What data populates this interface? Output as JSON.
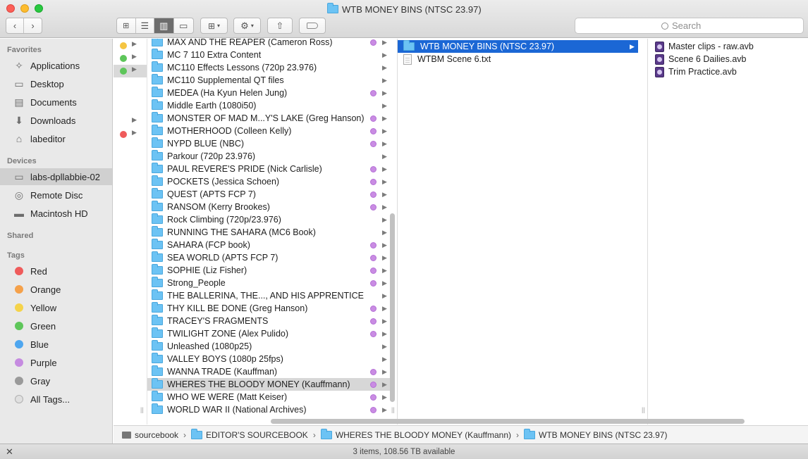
{
  "window": {
    "title": "WTB MONEY BINS (NTSC 23.97)"
  },
  "toolbar": {
    "search_placeholder": "Search",
    "view_icons": [
      "icon-view-icon",
      "list-view-icon",
      "column-view-icon",
      "cover-flow-icon"
    ],
    "active_view": "column"
  },
  "sidebar": {
    "favorites_label": "Favorites",
    "favorites": [
      {
        "label": "Applications",
        "icon": "applications-icon"
      },
      {
        "label": "Desktop",
        "icon": "desktop-icon"
      },
      {
        "label": "Documents",
        "icon": "documents-icon"
      },
      {
        "label": "Downloads",
        "icon": "downloads-icon"
      },
      {
        "label": "labeditor",
        "icon": "home-icon"
      }
    ],
    "devices_label": "Devices",
    "devices": [
      {
        "label": "labs-dpllabbie-02",
        "icon": "computer-icon",
        "selected": true
      },
      {
        "label": "Remote Disc",
        "icon": "remote-disc-icon"
      },
      {
        "label": "Macintosh HD",
        "icon": "hard-drive-icon"
      }
    ],
    "shared_label": "Shared",
    "tags_label": "Tags",
    "tags": [
      {
        "label": "Red",
        "color": "#ef5b5b"
      },
      {
        "label": "Orange",
        "color": "#f5a14a"
      },
      {
        "label": "Yellow",
        "color": "#f5d34a"
      },
      {
        "label": "Green",
        "color": "#5ec65a"
      },
      {
        "label": "Blue",
        "color": "#4ea6ef"
      },
      {
        "label": "Purple",
        "color": "#c58be0"
      },
      {
        "label": "Gray",
        "color": "#9a9a9a"
      },
      {
        "label": "All Tags...",
        "color": "#e0e0e0"
      }
    ]
  },
  "column1": {
    "rows": [
      {
        "tag_color": "#f5c542",
        "has_arrow": true,
        "selected": false
      },
      {
        "tag_color": "#5ec65a",
        "has_arrow": true,
        "selected": false
      },
      {
        "tag_color": "#5ec65a",
        "has_arrow": true,
        "selected": true
      },
      {
        "tag_color": "",
        "has_arrow": false,
        "selected": false
      },
      {
        "tag_color": "",
        "has_arrow": true,
        "selected": false
      },
      {
        "tag_color": "",
        "has_arrow": false,
        "selected": false
      },
      {
        "tag_color": "",
        "has_arrow": true,
        "selected": false
      },
      {
        "tag_color": "#ef5b5b",
        "has_arrow": true,
        "selected": false
      }
    ]
  },
  "column2": {
    "folders": [
      {
        "name": "MAX AND THE REAPER (Cameron Ross)",
        "purple": true
      },
      {
        "name": "MC 7 110 Extra Content",
        "purple": false
      },
      {
        "name": "MC110 Effects Lessons (720p 23.976)",
        "purple": false
      },
      {
        "name": "MC110 Supplemental QT files",
        "purple": false
      },
      {
        "name": "MEDEA (Ha Kyun Helen Jung)",
        "purple": true
      },
      {
        "name": "Middle Earth (1080i50)",
        "purple": false
      },
      {
        "name": "MONSTER OF MAD M...Y'S LAKE (Greg Hanson)",
        "purple": true
      },
      {
        "name": "MOTHERHOOD (Colleen Kelly)",
        "purple": true
      },
      {
        "name": "NYPD BLUE (NBC)",
        "purple": true
      },
      {
        "name": "Parkour (720p 23.976)",
        "purple": false
      },
      {
        "name": "PAUL REVERE'S PRIDE (Nick Carlisle)",
        "purple": true
      },
      {
        "name": "POCKETS (Jessica Schoen)",
        "purple": true
      },
      {
        "name": "QUEST (APTS FCP 7)",
        "purple": true
      },
      {
        "name": "RANSOM (Kerry Brookes)",
        "purple": true
      },
      {
        "name": "Rock Climbing (720p/23.976)",
        "purple": false
      },
      {
        "name": "RUNNING THE SAHARA (MC6 Book)",
        "purple": false
      },
      {
        "name": "SAHARA (FCP book)",
        "purple": true
      },
      {
        "name": "SEA WORLD (APTS FCP 7)",
        "purple": true
      },
      {
        "name": "SOPHIE (Liz Fisher)",
        "purple": true
      },
      {
        "name": "Strong_People",
        "purple": true
      },
      {
        "name": "THE BALLERINA, THE..., AND HIS APPRENTICE",
        "purple": false
      },
      {
        "name": "THY KILL BE DONE (Greg Hanson)",
        "purple": true
      },
      {
        "name": "TRACEY'S FRAGMENTS",
        "purple": true
      },
      {
        "name": "TWILIGHT ZONE (Alex Pulido)",
        "purple": true
      },
      {
        "name": "Unleashed (1080p25)",
        "purple": false
      },
      {
        "name": "VALLEY BOYS (1080p 25fps)",
        "purple": false
      },
      {
        "name": "WANNA TRADE (Kauffman)",
        "purple": true
      },
      {
        "name": "WHERES THE BLOODY MONEY (Kauffmann)",
        "purple": true,
        "selected": true
      },
      {
        "name": "WHO WE WERE (Matt Keiser)",
        "purple": true
      },
      {
        "name": "WORLD WAR II (National Archives)",
        "purple": true
      }
    ]
  },
  "column3": {
    "items": [
      {
        "name": "WTB MONEY BINS (NTSC 23.97)",
        "kind": "folder",
        "selected": true
      },
      {
        "name": "WTBM Scene 6.txt",
        "kind": "text"
      }
    ]
  },
  "column4": {
    "items": [
      {
        "name": "Master clips - raw.avb"
      },
      {
        "name": "Scene 6 Dailies.avb"
      },
      {
        "name": "Trim Practice.avb"
      }
    ]
  },
  "pathbar": {
    "items": [
      {
        "label": "sourcebook",
        "icon": "disk-icon"
      },
      {
        "label": "EDITOR'S SOURCEBOOK",
        "icon": "folder-icon"
      },
      {
        "label": "WHERES THE BLOODY MONEY (Kauffmann)",
        "icon": "folder-icon"
      },
      {
        "label": "WTB MONEY BINS (NTSC 23.97)",
        "icon": "folder-icon"
      }
    ],
    "separator": "›"
  },
  "status": {
    "text": "3 items, 108.56 TB available"
  }
}
